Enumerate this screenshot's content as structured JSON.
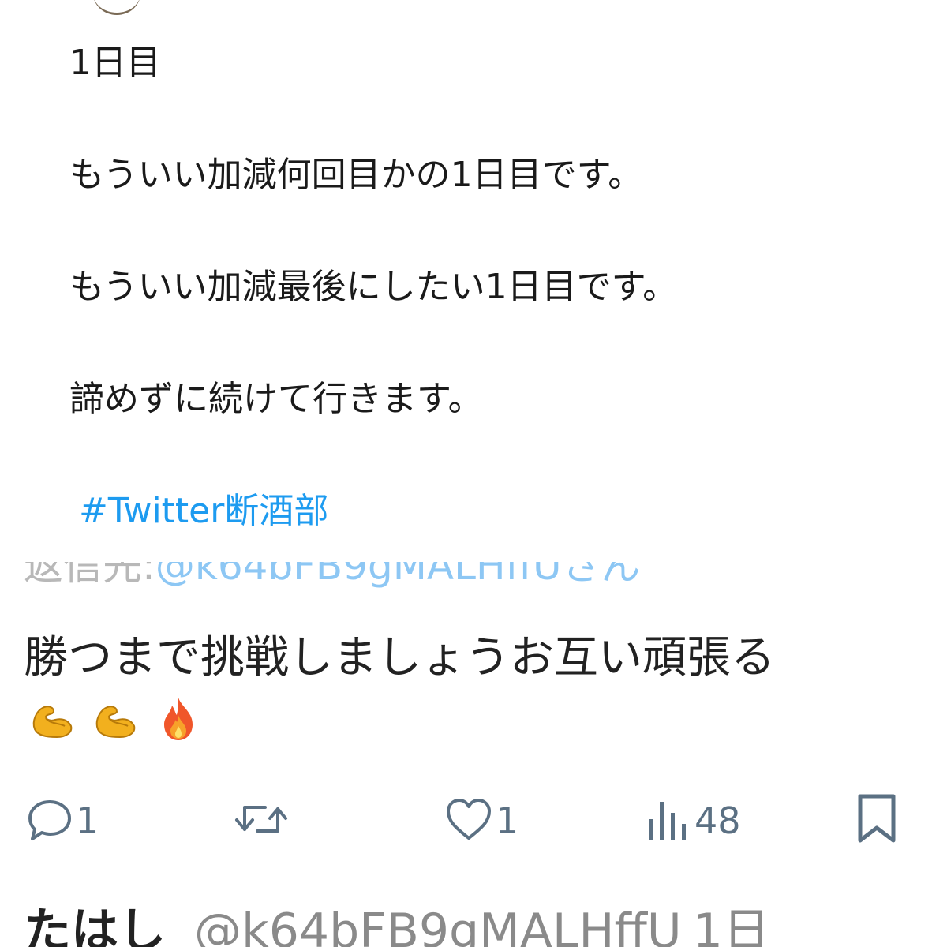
{
  "quoted_tweet": {
    "lines": [
      "1日目",
      "もういい加減何回目かの1日目です。",
      "もういい加減最後にしたい1日目です。",
      "諦めずに続けて行きます。"
    ],
    "hashtag": "#Twitter断酒部"
  },
  "reply": {
    "reply_to_prefix": "返信先:",
    "reply_to_handle": "@k64bFB9gMALHffUさん",
    "text": "勝つまで挑戦しましょうお互い頑張る",
    "emojis": [
      "flexed-biceps-icon",
      "flexed-biceps-icon",
      "fire-icon"
    ]
  },
  "actions": {
    "reply_count": "1",
    "retweet_count": "",
    "like_count": "1",
    "views_count": "48"
  },
  "next_tweet": {
    "author_name": "たはし",
    "handle": "@k64bFB9gMALHffU",
    "time": "1日"
  },
  "colors": {
    "link": "#1d9bf0",
    "icon": "#5b7083",
    "text": "#1a1a1a"
  }
}
